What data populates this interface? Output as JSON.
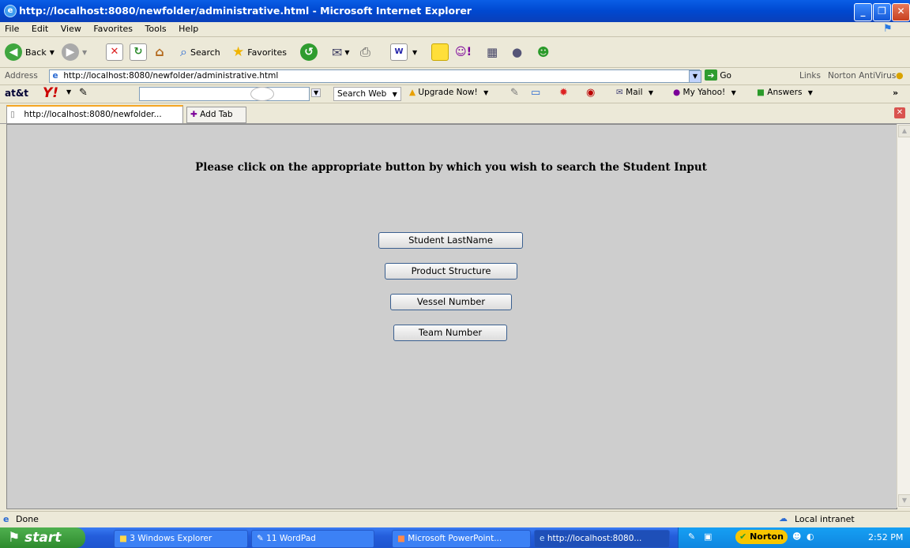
{
  "window": {
    "title": "http://localhost:8080/newfolder/administrative.html - Microsoft Internet Explorer"
  },
  "menu": [
    "File",
    "Edit",
    "View",
    "Favorites",
    "Tools",
    "Help"
  ],
  "toolbar": {
    "back": "Back",
    "search": "Search",
    "favorites": "Favorites"
  },
  "address": {
    "label": "Address",
    "url": "http://localhost:8080/newfolder/administrative.html",
    "go": "Go",
    "links": "Links",
    "norton": "Norton AntiVirus"
  },
  "yahoo_toolbar": {
    "att": "at&t",
    "search_web": "Search Web",
    "upgrade": "Upgrade Now!",
    "mail": "Mail",
    "my_yahoo": "My Yahoo!",
    "answers": "Answers"
  },
  "tabs": {
    "current": "http://localhost:8080/newfolder...",
    "add": "Add Tab"
  },
  "page": {
    "heading": "Please click on the appropriate button by which you wish to search the Student Input",
    "buttons": [
      "Student LastName",
      "Product Structure",
      "Vessel Number",
      "Team Number"
    ]
  },
  "status": {
    "text": "Done",
    "zone": "Local intranet"
  },
  "taskbar": {
    "start": "start",
    "items": [
      "3 Windows Explorer",
      "11 WordPad",
      "Microsoft PowerPoint...",
      "http://localhost:8080..."
    ],
    "norton": "Norton",
    "clock": "2:52 PM"
  }
}
